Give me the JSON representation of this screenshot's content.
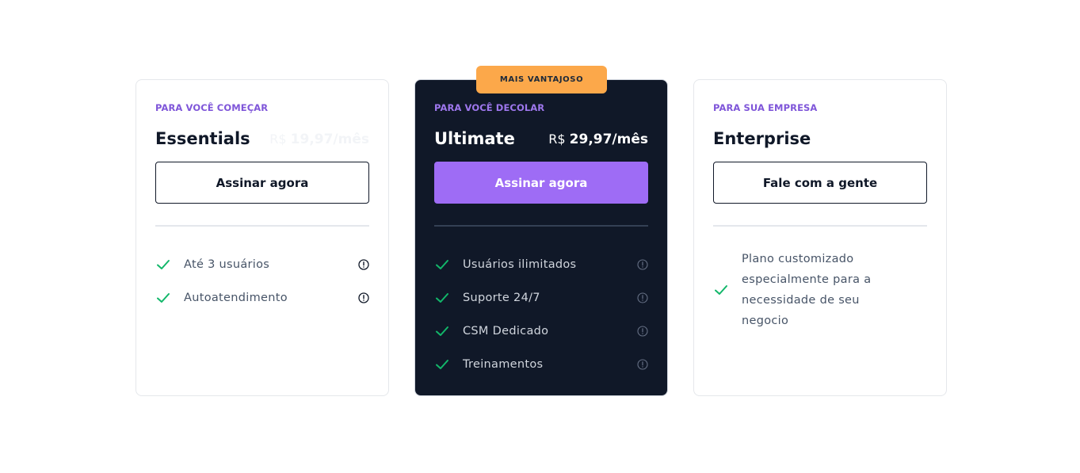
{
  "badge": "MAIS VANTAJOSO",
  "colors": {
    "accent": "#7f56d9",
    "primary_button": "#9e6cf5",
    "badge": "#fca84a",
    "dark_card": "#101828",
    "check_green": "#12b76a"
  },
  "plans": [
    {
      "eyebrow": "PARA VOCÊ COMEÇAR",
      "title": "Essentials",
      "price_prefix": "R$",
      "price_amount": "19,97/mês",
      "cta": "Assinar agora",
      "features": [
        "Até 3 usuários",
        "Autoatendimento"
      ]
    },
    {
      "eyebrow": "PARA VOCÊ DECOLAR",
      "title": "Ultimate",
      "price_prefix": "R$",
      "price_amount": "29,97/mês",
      "cta": "Assinar agora",
      "features": [
        "Usuários ilimitados",
        "Suporte 24/7",
        "CSM Dedicado",
        "Treinamentos"
      ]
    },
    {
      "eyebrow": "PARA SUA EMPRESA",
      "title": "Enterprise",
      "cta": "Fale com a gente",
      "features": [
        "Plano customizado especialmente para a necessidade de seu negocio"
      ]
    }
  ],
  "icons": {
    "check": "check-icon",
    "info": "info-icon"
  }
}
